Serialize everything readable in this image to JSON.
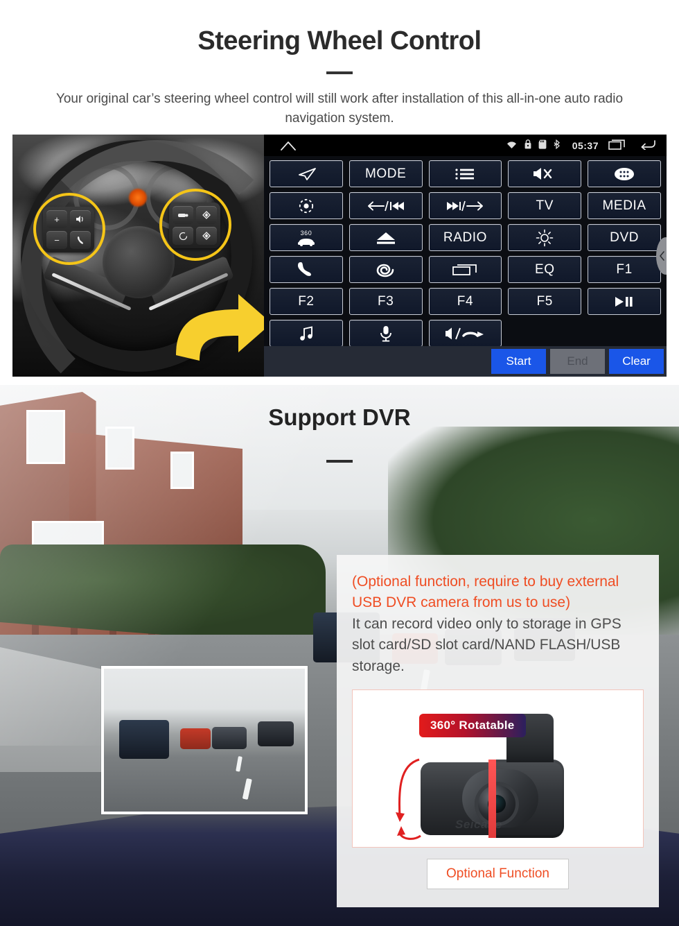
{
  "swc": {
    "title": "Steering Wheel Control",
    "subtitle": "Your original car’s steering wheel control will still work after installation of this all-in-one auto radio navigation system."
  },
  "headunit": {
    "status": {
      "home_icon": "home-icon",
      "wifi_icon": "wifi-icon",
      "lock_icon": "lock-icon",
      "sdcard_icon": "sd-card-icon",
      "bluetooth_icon": "bluetooth-icon",
      "clock": "05:37",
      "recents_icon": "recent-apps-icon",
      "back_icon": "back-arrow-icon"
    },
    "keys": [
      {
        "label": "",
        "icon": "navigation-arrow-icon"
      },
      {
        "label": "MODE",
        "icon": ""
      },
      {
        "label": "",
        "icon": "list-icon"
      },
      {
        "label": "",
        "icon": "mute-icon"
      },
      {
        "label": "",
        "icon": "apps-grid-icon"
      },
      {
        "label": "",
        "icon": "power-icon"
      },
      {
        "label": "",
        "icon": "prev-track-icon"
      },
      {
        "label": "",
        "icon": "next-track-icon"
      },
      {
        "label": "TV",
        "icon": ""
      },
      {
        "label": "MEDIA",
        "icon": ""
      },
      {
        "label": "",
        "icon": "360-camera-icon"
      },
      {
        "label": "",
        "icon": "eject-icon"
      },
      {
        "label": "RADIO",
        "icon": ""
      },
      {
        "label": "",
        "icon": "brightness-icon"
      },
      {
        "label": "DVD",
        "icon": ""
      },
      {
        "label": "",
        "icon": "phone-icon"
      },
      {
        "label": "",
        "icon": "spiral-icon"
      },
      {
        "label": "",
        "icon": "screen-off-icon"
      },
      {
        "label": "EQ",
        "icon": ""
      },
      {
        "label": "F1",
        "icon": ""
      },
      {
        "label": "F2",
        "icon": ""
      },
      {
        "label": "F3",
        "icon": ""
      },
      {
        "label": "F4",
        "icon": ""
      },
      {
        "label": "F5",
        "icon": ""
      },
      {
        "label": "",
        "icon": "play-pause-icon"
      },
      {
        "label": "",
        "icon": "music-note-icon"
      },
      {
        "label": "",
        "icon": "microphone-icon"
      },
      {
        "label": "",
        "icon": "speaker-hangup-icon"
      }
    ],
    "actions": {
      "start": "Start",
      "end": "End",
      "clear": "Clear"
    },
    "side_tab_icon": "chevron-left-icon",
    "colors": {
      "key_border": "#c8ccd6",
      "key_fill": "#16203a",
      "action_blue": "#1a56e8",
      "action_disabled": "#6d7078"
    }
  },
  "dvr": {
    "title": "Support DVR",
    "note_orange": "(Optional function, require to buy external USB DVR camera from us to use)",
    "note_gray": "It can record video only to storage in GPS slot card/SD slot card/NAND FLASH/USB storage.",
    "badge": "360° Rotatable",
    "brand": "Seicane",
    "optional_button": "Optional Function",
    "colors": {
      "orange": "#ef4d23",
      "badge_start": "#e21b1b",
      "badge_end": "#2b1f5e",
      "highlight_ring": "#f5c518"
    }
  }
}
